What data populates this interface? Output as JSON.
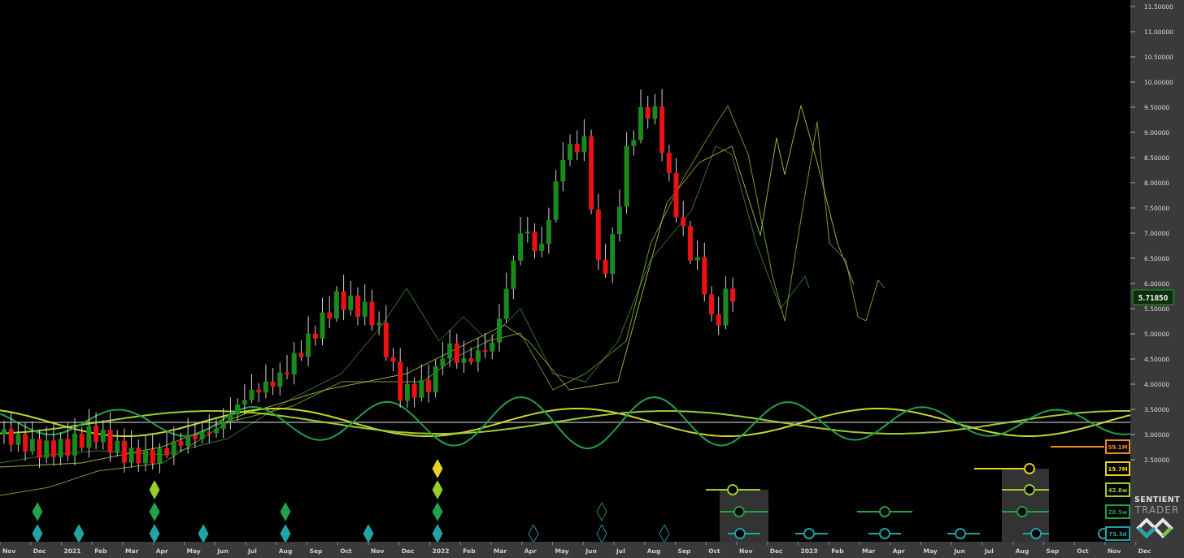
{
  "chart": {
    "last_price": "5.71850",
    "y_axis": [
      "11.50000",
      "11.00000",
      "10.50000",
      "10.00000",
      "9.50000",
      "9.00000",
      "8.50000",
      "8.00000",
      "7.50000",
      "7.00000",
      "6.50000",
      "6.00000",
      "5.50000",
      "5.00000",
      "4.50000",
      "4.00000",
      "3.50000",
      "3.00000",
      "2.50000"
    ],
    "x_axis": [
      "Nov",
      "Dec",
      "2021",
      "Feb",
      "Mar",
      "Apr",
      "May",
      "Jun",
      "Jul",
      "Aug",
      "Sep",
      "Oct",
      "Nov",
      "Dec",
      "2022",
      "Feb",
      "Mar",
      "Apr",
      "May",
      "Jun",
      "Jul",
      "Aug",
      "Sep",
      "Oct",
      "Nov",
      "Dec",
      "2023",
      "Feb",
      "Mar",
      "Apr",
      "May",
      "Jun",
      "Jul",
      "Aug",
      "Sep",
      "Oct",
      "Nov",
      "Dec"
    ]
  },
  "cycles": [
    {
      "label": "59.1M",
      "color": "#f08a24"
    },
    {
      "label": "19.7M",
      "color": "#e6d21e"
    },
    {
      "label": "42.8w",
      "color": "#9acd32"
    },
    {
      "label": "20.5w",
      "color": "#22a04a"
    },
    {
      "label": "75.3d",
      "color": "#1fa5a5"
    }
  ],
  "logo": {
    "line_1": "SENTIENT",
    "line_2": "TRADER"
  }
}
